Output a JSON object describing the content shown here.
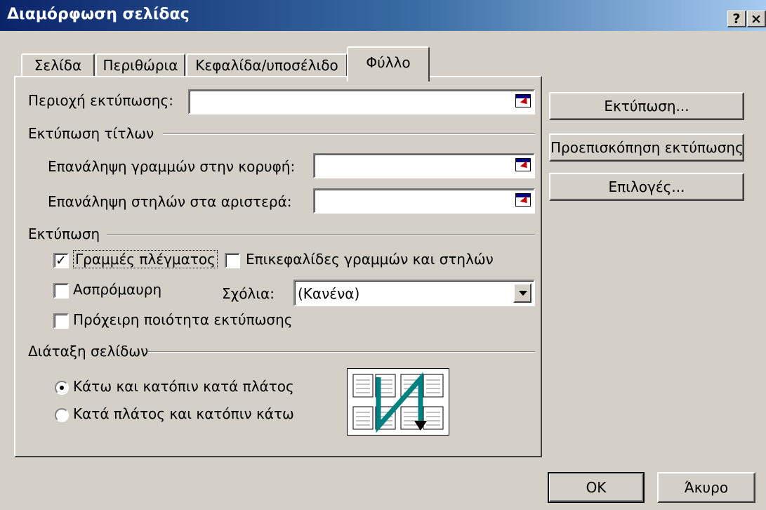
{
  "window": {
    "title": "Διαμόρφωση σελίδας",
    "help_button": "?",
    "close_button": "×"
  },
  "tabs": [
    {
      "label": "Σελίδα"
    },
    {
      "label": "Περιθώρια"
    },
    {
      "label": "Κεφαλίδα/υποσέλιδο"
    },
    {
      "label": "Φύλλο",
      "active": true
    }
  ],
  "print_area": {
    "label": "Περιοχή εκτύπωσης:",
    "value": ""
  },
  "print_titles": {
    "heading": "Εκτύπωση τίτλων",
    "rows_label": "Επανάληψη γραμμών στην κορυφή:",
    "rows_value": "",
    "cols_label": "Επανάληψη στηλών στα αριστερά:",
    "cols_value": ""
  },
  "print": {
    "heading": "Εκτύπωση",
    "gridlines": {
      "label": "Γραμμές πλέγματος",
      "checked": true
    },
    "headings": {
      "label": "Επικεφαλίδες γραμμών και στηλών",
      "checked": false
    },
    "black_white": {
      "label": "Ασπρόμαυρη",
      "checked": false
    },
    "draft": {
      "label": "Πρόχειρη ποιότητα εκτύπωσης",
      "checked": false
    },
    "comments_label": "Σχόλια:",
    "comments_value": "(Κανένα)"
  },
  "page_order": {
    "heading": "Διάταξη σελίδων",
    "down_then_over": {
      "label": "Κάτω και κατόπιν κατά πλάτος",
      "selected": true
    },
    "over_then_down": {
      "label": "Κατά πλάτος και κατόπιν κάτω",
      "selected": false
    }
  },
  "side_buttons": {
    "print": "Εκτύπωση...",
    "preview": "Προεπισκόπηση εκτύπωσης",
    "options": "Επιλογές..."
  },
  "footer": {
    "ok": "OK",
    "cancel": "Άκυρο"
  },
  "colors": {
    "title_start": "#0a246a",
    "title_end": "#a6caf0",
    "face": "#d4d0c8",
    "arrow": "#008080"
  }
}
